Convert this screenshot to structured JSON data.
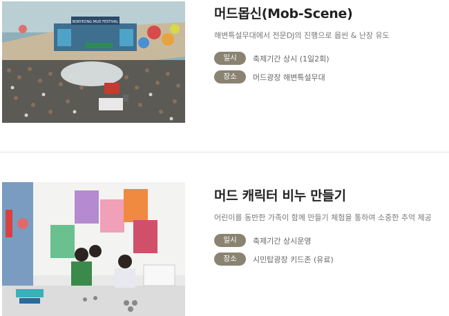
{
  "programs": [
    {
      "title": "머드몹신(Mob-Scene)",
      "description": "해변특설무대에서 전문DJ의 진행으로 몹씬 & 난장 유도",
      "rows": [
        {
          "badge": "일시",
          "value": "축제기간 상시 (1일2회)"
        },
        {
          "badge": "장소",
          "value": "머드광장 해변특설무대"
        }
      ],
      "stage_sign": "BORYEONG MUD FESTIVAL"
    },
    {
      "title": "머드 캐릭터 비누 만들기",
      "description": "어린이를 동반한 가족이 함께 만들기 체험을 통하여 소중한 추억 제공",
      "rows": [
        {
          "badge": "일시",
          "value": "축제기간 상시운영"
        },
        {
          "badge": "장소",
          "value": "시민탑광장 키드존 (유료)"
        }
      ]
    }
  ],
  "colors": {
    "badge": "#8a8372",
    "title": "#222222",
    "description": "#777777",
    "divider": "#e6e6e6"
  }
}
